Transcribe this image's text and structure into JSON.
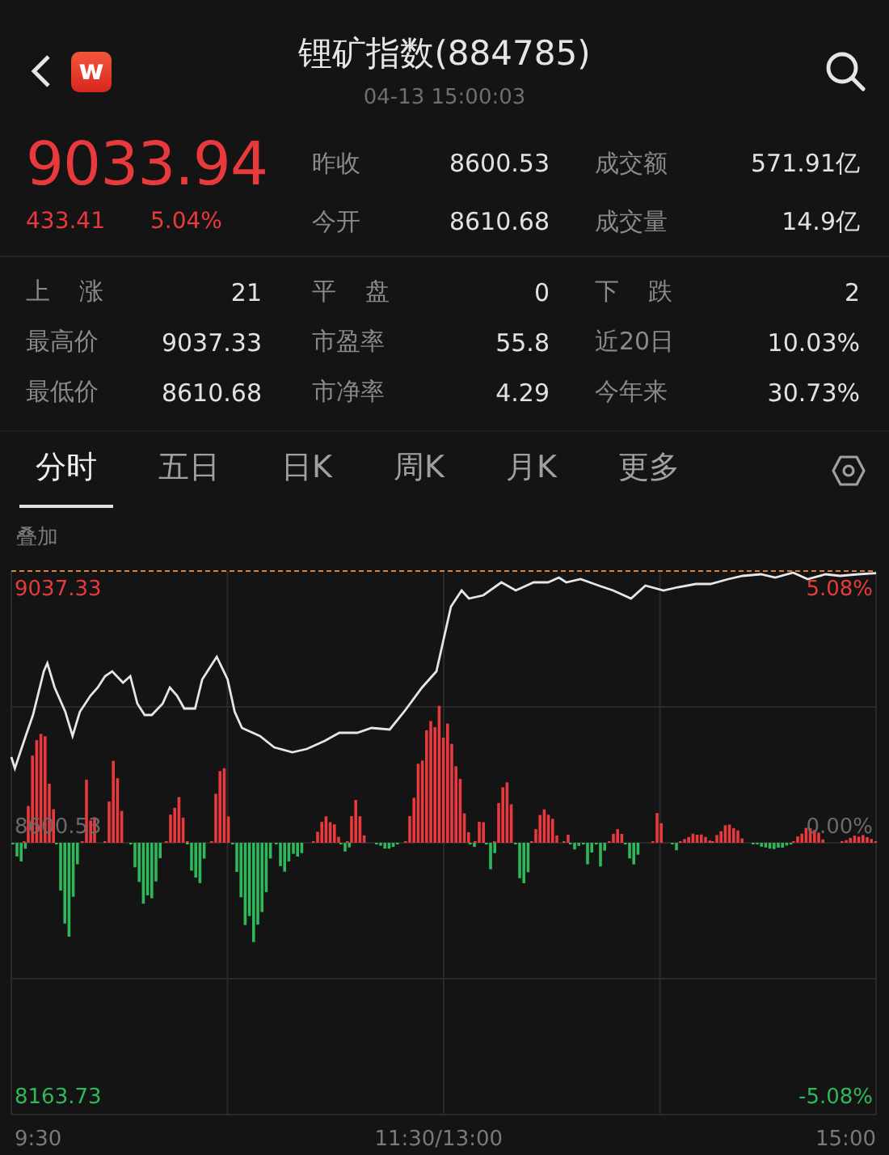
{
  "header": {
    "title": "锂矿指数(884785)",
    "timestamp": "04-13 15:00:03",
    "logo_letter": "w"
  },
  "quote": {
    "price": "9033.94",
    "change": "433.41",
    "change_pct": "5.04%"
  },
  "summary": [
    {
      "label": "昨收",
      "value": "8600.53"
    },
    {
      "label": "成交额",
      "value": "571.91亿"
    },
    {
      "label": "今开",
      "value": "8610.68"
    },
    {
      "label": "成交量",
      "value": "14.9亿"
    }
  ],
  "stats": [
    {
      "label": "上 涨",
      "value": "21",
      "spaced": true
    },
    {
      "label": "平 盘",
      "value": "0",
      "spaced": true
    },
    {
      "label": "下 跌",
      "value": "2",
      "spaced": true
    },
    {
      "label": "最高价",
      "value": "9037.33",
      "spaced": false
    },
    {
      "label": "市盈率",
      "value": "55.8",
      "spaced": false
    },
    {
      "label": "近20日",
      "value": "10.03%",
      "spaced": false
    },
    {
      "label": "最低价",
      "value": "8610.68",
      "spaced": false
    },
    {
      "label": "市净率",
      "value": "4.29",
      "spaced": false
    },
    {
      "label": "今年来",
      "value": "30.73%",
      "spaced": false
    }
  ],
  "tabs": [
    {
      "label": "分时",
      "selected": true
    },
    {
      "label": "五日",
      "selected": false
    },
    {
      "label": "日K",
      "selected": false
    },
    {
      "label": "周K",
      "selected": false
    },
    {
      "label": "月K",
      "selected": false
    },
    {
      "label": "更多",
      "selected": false
    }
  ],
  "chart": {
    "overlay_label": "叠加",
    "price_labels": [
      "9037.33",
      "8600.53",
      "8163.73"
    ],
    "right_labels": [
      "5.08%",
      "0.00%",
      "-5.08%"
    ],
    "time_labels": [
      "9:30",
      "11:30/13:00",
      "15:00"
    ]
  }
}
